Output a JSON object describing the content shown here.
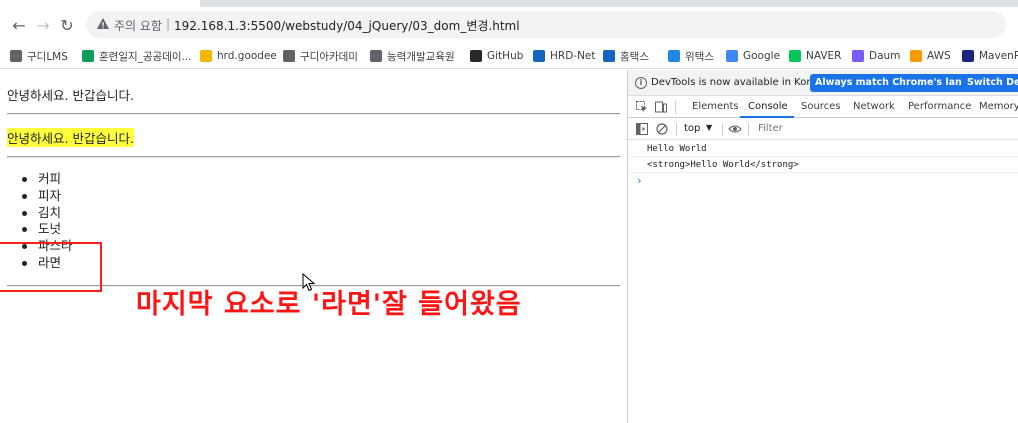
{
  "browser": {
    "security_label": "주의 요함",
    "url": "192.168.1.3:5500/webstudy/04_jQuery/03_dom_변경.html",
    "bookmarks": [
      {
        "label": "구디LMS",
        "color": "#5f6368"
      },
      {
        "label": "훈련일지_공공데이...",
        "color": "#0f9d58"
      },
      {
        "label": "hrd.goodee",
        "color": "#f4b400"
      },
      {
        "label": "구디아카데미",
        "color": "#5f6368"
      },
      {
        "label": "능력개발교육원",
        "color": "#5f6368"
      },
      {
        "label": "GitHub",
        "color": "#24292e"
      },
      {
        "label": "HRD-Net",
        "color": "#1565c0"
      },
      {
        "label": "홈택스",
        "color": "#1565c0"
      },
      {
        "label": "위택스",
        "color": "#1e88e5"
      },
      {
        "label": "Google",
        "color": "#4285f4"
      },
      {
        "label": "NAVER",
        "color": "#03c75a"
      },
      {
        "label": "Daum",
        "color": "#7b5cff"
      },
      {
        "label": "AWS",
        "color": "#ff9900"
      },
      {
        "label": "MavenRe",
        "color": "#1a237e"
      }
    ]
  },
  "page": {
    "greeting1": "안녕하세요. 반갑습니다.",
    "greeting2": "안녕하세요. 반갑습니다.",
    "list_items": [
      "커피",
      "피자",
      "김치",
      "도넛",
      "파스타",
      "라면"
    ]
  },
  "annotation": {
    "text": "마지막 요소로 '라면'잘 들어왔음",
    "color": "#ff1414"
  },
  "devtools": {
    "info_message": "DevTools is now available in Korean!",
    "match_language_button": "Always match Chrome's language",
    "switch_button": "Switch DevT",
    "tabs": [
      "Elements",
      "Console",
      "Sources",
      "Network",
      "Performance",
      "Memory"
    ],
    "active_tab": "Console",
    "context": "top",
    "filter_placeholder": "Filter",
    "console_lines": [
      "Hello World",
      "<strong>Hello World</strong>"
    ],
    "prompt": "›"
  }
}
